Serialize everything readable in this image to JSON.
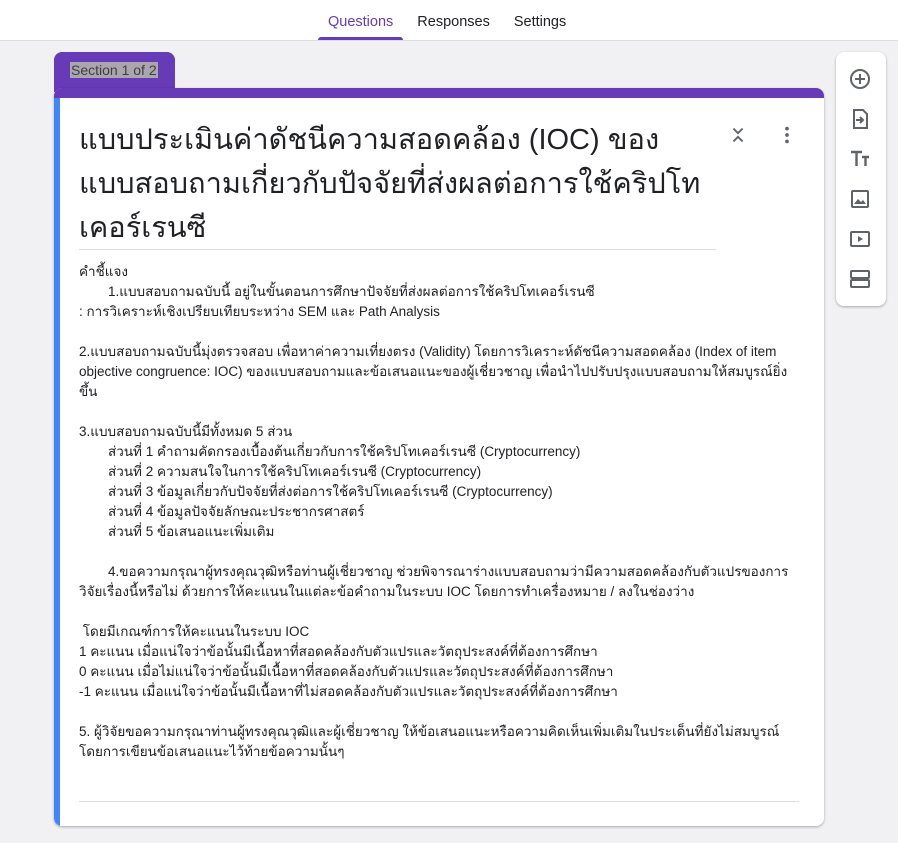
{
  "tabs": [
    {
      "label": "Questions",
      "active": true
    },
    {
      "label": "Responses"
    },
    {
      "label": "Settings"
    }
  ],
  "section_label": "Section 1 of 2",
  "form": {
    "title": "แบบประเมินค่าดัชนีความสอดคล้อง (IOC) ของแบบสอบถามเกี่ยวกับปัจจัยที่ส่งผลต่อการใช้คริปโทเคอร์เรนซี",
    "description": [
      {
        "text": "คำชี้แจง"
      },
      {
        "text": "1.แบบสอบถามฉบับนี้ อยู่ในขั้นตอนการศึกษาปัจจัยที่ส่งผลต่อการใช้คริปโทเคอร์เรนซี",
        "indent": true
      },
      {
        "text": ": การวิเคราะห์เชิงเปรียบเทียบระหว่าง SEM และ Path Analysis"
      },
      {
        "text": ""
      },
      {
        "text": "2.แบบสอบถามฉบับนี้มุ่งตรวจสอบ เพื่อหาค่าความเที่ยงตรง (Validity) โดยการวิเคราะห์ดัชนีความสอดคล้อง (Index of item objective congruence: IOC) ของแบบสอบถามและข้อเสนอแนะของผู้เชี่ยวชาญ เพื่อนำไปปรับปรุงแบบสอบถามให้สมบูรณ์ยิ่งขึ้น"
      },
      {
        "text": ""
      },
      {
        "text": "3.แบบสอบถามฉบับนี้มีทั้งหมด 5 ส่วน"
      },
      {
        "text": "ส่วนที่ 1 คำถามคัดกรองเบื้องต้นเกี่ยวกับการใช้คริปโทเคอร์เรนซี (Cryptocurrency)",
        "indent": true
      },
      {
        "text": "ส่วนที่ 2 ความสนใจในการใช้คริปโทเคอร์เรนซี (Cryptocurrency)",
        "indent": true
      },
      {
        "text": "ส่วนที่ 3 ข้อมูลเกี่ยวกับปัจจัยที่ส่งต่อการใช้คริปโทเคอร์เรนซี (Cryptocurrency)",
        "indent": true
      },
      {
        "text": "ส่วนที่ 4 ข้อมูลปัจจัยลักษณะประชากรศาสตร์",
        "indent": true
      },
      {
        "text": "ส่วนที่ 5 ข้อเสนอแนะเพิ่มเติม",
        "indent": true
      },
      {
        "text": ""
      },
      {
        "text": "4.ขอความกรุณาผู้ทรงคุณวุฒิหรือท่านผู้เชี่ยวชาญ ช่วยพิจารณาร่างแบบสอบถามว่ามีความสอดคล้องกับตัวแปรของการวิจัยเรื่องนี้หรือไม่ ด้วยการให้คะแนนในแต่ละข้อคำถามในระบบ IOC โดยการทำเครื่องหมาย / ลงในช่องว่าง",
        "first_indent": true
      },
      {
        "text": ""
      },
      {
        "text": " โดยมีเกณฑ์การให้คะแนนในระบบ IOC"
      },
      {
        "text": "1 คะแนน เมื่อแน่ใจว่าข้อนั้นมีเนื้อหาที่สอดคล้องกับตัวแปรและวัตถุประสงค์ที่ต้องการศึกษา"
      },
      {
        "text": "0 คะแนน เมื่อไม่แน่ใจว่าข้อนั้นมีเนื้อหาที่สอดคล้องกับตัวแปรและวัตถุประสงค์ที่ต้องการศึกษา"
      },
      {
        "text": "-1 คะแนน เมื่อแน่ใจว่าข้อนั้นมีเนื้อหาที่ไม่สอดคล้องกับตัวแปรและวัตถุประสงค์ที่ต้องการศึกษา"
      },
      {
        "text": ""
      },
      {
        "text": "5. ผู้วิจัยขอความกรุณาท่านผู้ทรงคุณวุฒิและผู้เชี่ยวชาญ ให้ข้อเสนอแนะหรือความคิดเห็นเพิ่มเติมในประเด็นที่ยังไม่สมบูรณ์ โดยการเขียนข้อเสนอแนะไว้ท้ายข้อความนั้นๆ"
      }
    ]
  },
  "toolbar_icons": [
    "add-question-icon",
    "import-questions-icon",
    "add-title-icon",
    "add-image-icon",
    "add-video-icon",
    "add-section-icon"
  ],
  "colors": {
    "accent": "#673ab7",
    "focus": "#4285f4"
  }
}
